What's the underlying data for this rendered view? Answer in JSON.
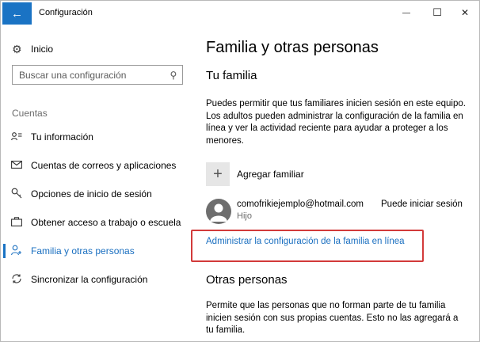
{
  "window": {
    "title": "Configuración",
    "back_glyph": "←",
    "minimize_glyph": "—",
    "maximize_glyph": "☐",
    "close_glyph": "✕"
  },
  "sidebar": {
    "home": {
      "icon": "gear-icon",
      "label": "Inicio"
    },
    "search": {
      "placeholder": "Buscar una configuración",
      "value": "",
      "icon": "search-icon"
    },
    "section_label": "Cuentas",
    "items": [
      {
        "label": "Tu información",
        "icon": "person-card-icon",
        "active": false
      },
      {
        "label": "Cuentas de correos y aplicaciones",
        "icon": "mail-icon",
        "active": false
      },
      {
        "label": "Opciones de inicio de sesión",
        "icon": "key-icon",
        "active": false
      },
      {
        "label": "Obtener acceso a trabajo o escuela",
        "icon": "briefcase-icon",
        "active": false
      },
      {
        "label": "Familia y otras personas",
        "icon": "person-add-icon",
        "active": true
      },
      {
        "label": "Sincronizar la configuración",
        "icon": "sync-icon",
        "active": false
      }
    ]
  },
  "main": {
    "page_title": "Familia y otras personas",
    "family": {
      "heading": "Tu familia",
      "description": "Puedes permitir que tus familiares inicien sesión en este equipo. Los adultos pueden administrar la configuración de la familia en línea y ver la actividad reciente para ayudar a proteger a los menores.",
      "add_label": "Agregar familiar",
      "member": {
        "email": "comofrikiejemplo@hotmail.com",
        "role": "Hijo",
        "status": "Puede iniciar sesión"
      },
      "manage_link": "Administrar la configuración de la familia en línea"
    },
    "others": {
      "heading": "Otras personas",
      "description": "Permite que las personas que no forman parte de tu familia inicien sesión con sus propias cuentas. Esto no las agregará a tu familia."
    }
  },
  "colors": {
    "accent": "#1a73c4",
    "link": "#1a6fc0",
    "highlight": "#d23a3a"
  }
}
